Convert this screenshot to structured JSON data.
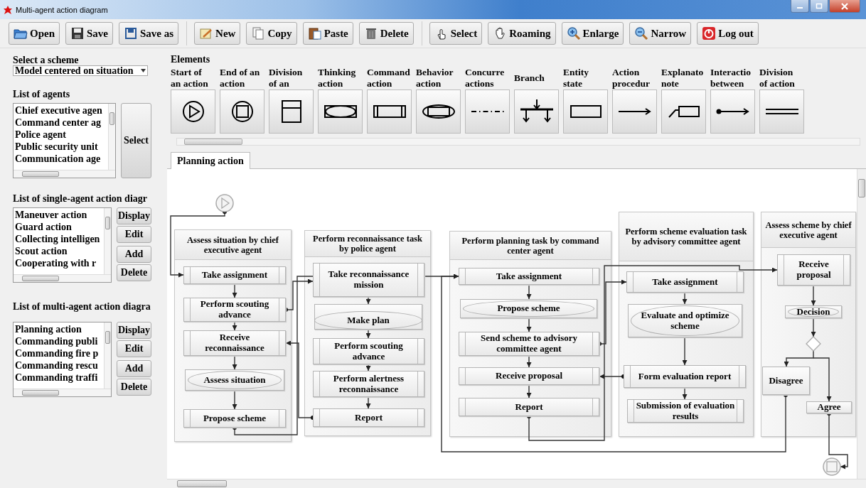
{
  "window": {
    "title": "Multi-agent action diagram"
  },
  "toolbar": [
    [
      "Open",
      "Save",
      "Save as"
    ],
    [
      "New",
      "Copy",
      "Paste",
      "Delete"
    ],
    [
      "Select",
      "Roaming",
      "Enlarge",
      "Narrow",
      "Log out"
    ]
  ],
  "scheme": {
    "label": "Select a scheme",
    "value": "Model centered on situation"
  },
  "agents": {
    "title": "List of agents",
    "items": [
      "Chief executive agen",
      "Command center ag",
      "Police agent",
      "Public security unit",
      "Communication age"
    ],
    "button": "Select"
  },
  "single_agent_diagrams": {
    "title": "List of single-agent action diagr",
    "items": [
      "Maneuver action",
      "Guard action",
      "Collecting intelligen",
      "Scout action",
      "Cooperating with r"
    ],
    "buttons": [
      "Display",
      "Edit",
      "Add",
      "Delete"
    ]
  },
  "multi_agent_diagrams": {
    "title": "List of multi-agent action diagra",
    "items": [
      "Planning action",
      "Commanding publi",
      "Commanding fire p",
      "Commanding rescu",
      "Commanding traffi"
    ],
    "buttons": [
      "Display",
      "Edit",
      "Add",
      "Delete"
    ]
  },
  "elements": {
    "title": "Elements",
    "items": [
      {
        "label": "Start of\nan action",
        "kind": "start"
      },
      {
        "label": "End of an\naction",
        "kind": "end"
      },
      {
        "label": "Division\nof an",
        "kind": "division"
      },
      {
        "label": "Thinking\naction",
        "kind": "thinking"
      },
      {
        "label": "Command\naction",
        "kind": "command"
      },
      {
        "label": "Behavior\naction",
        "kind": "behavior"
      },
      {
        "label": "Concurre\nactions",
        "kind": "concurrent"
      },
      {
        "label": "Branch",
        "kind": "branch"
      },
      {
        "label": "Entity\nstate",
        "kind": "entity"
      },
      {
        "label": "Action\nprocedur",
        "kind": "procedure"
      },
      {
        "label": "Explanato\nnote",
        "kind": "note"
      },
      {
        "label": "Interactio\nbetween",
        "kind": "interaction"
      },
      {
        "label": "Division\nof action",
        "kind": "division_action"
      }
    ]
  },
  "tabs": [
    {
      "label": "Planning action",
      "selected": true
    }
  ],
  "diagram": {
    "lanes": [
      {
        "title": "Assess situation by chief executive agent",
        "nodes": [
          {
            "text": "Take assignment",
            "kind": "activity"
          },
          {
            "text": "Perform scouting advance",
            "kind": "activity"
          },
          {
            "text": "Receive reconnaissance",
            "kind": "activity"
          },
          {
            "text": "Assess situation",
            "kind": "thinking"
          },
          {
            "text": "Propose scheme",
            "kind": "activity"
          }
        ]
      },
      {
        "title": "Perform reconnaissance task by police agent",
        "nodes": [
          {
            "text": "Take reconnaissance mission",
            "kind": "activity"
          },
          {
            "text": "Make plan",
            "kind": "plan"
          },
          {
            "text": "Perform scouting advance",
            "kind": "activity"
          },
          {
            "text": "Perform alertness reconnaissance",
            "kind": "activity"
          },
          {
            "text": "Report",
            "kind": "activity"
          }
        ]
      },
      {
        "title": "Perform planning task by command center agent",
        "nodes": [
          {
            "text": "Take assignment",
            "kind": "activity"
          },
          {
            "text": "Propose scheme",
            "kind": "thinking"
          },
          {
            "text": "Send scheme to advisory committee agent",
            "kind": "activity"
          },
          {
            "text": "Receive proposal",
            "kind": "activity"
          },
          {
            "text": "Report",
            "kind": "activity"
          }
        ]
      },
      {
        "title": "Perform scheme evaluation task by advisory committee agent",
        "nodes": [
          {
            "text": "Take assignment",
            "kind": "activity"
          },
          {
            "text": "Evaluate and optimize scheme",
            "kind": "thinking"
          },
          {
            "text": "Form evaluation report",
            "kind": "activity"
          },
          {
            "text": "Submission of evaluation results",
            "kind": "activity"
          }
        ]
      },
      {
        "title": "Assess scheme by chief executive agent",
        "nodes": [
          {
            "text": "Receive proposal",
            "kind": "activity"
          },
          {
            "text": "Decision",
            "kind": "thinking"
          },
          {
            "text": "Disagree",
            "kind": "state"
          },
          {
            "text": "Agree",
            "kind": "state"
          }
        ]
      }
    ]
  }
}
